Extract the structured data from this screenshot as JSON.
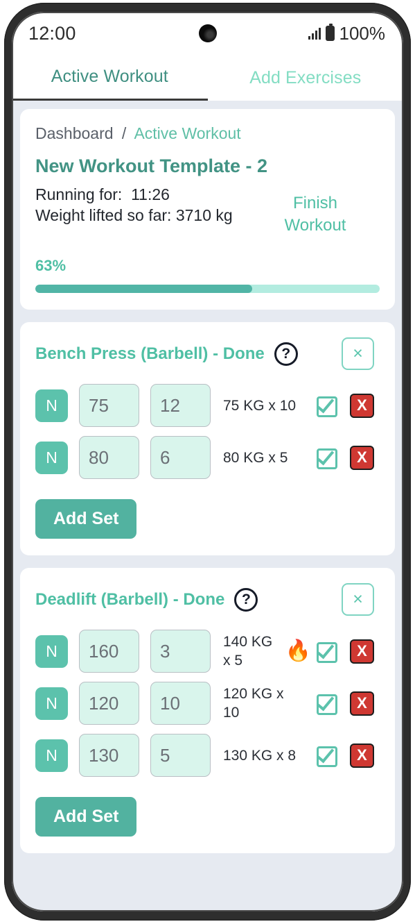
{
  "status_bar": {
    "time": "12:00",
    "battery_percent": "100%",
    "signal_icon": "signal-bars-icon",
    "battery_icon": "battery-full-icon",
    "camera_icon": "front-camera-punch-hole"
  },
  "tabs": [
    {
      "label": "Active Workout",
      "active": true
    },
    {
      "label": "Add Exercises",
      "active": false
    }
  ],
  "header": {
    "breadcrumb": {
      "root": "Dashboard",
      "separator": "/",
      "current": "Active Workout"
    },
    "workout_title": "New Workout Template - 2",
    "running_for_label": "Running for:",
    "running_for_value": "11:26",
    "weight_lifted": "Weight lifted so far: 3710 kg",
    "finish_button": "Finish Workout",
    "progress_percent_label": "63%",
    "progress_percent_value": 63,
    "accent_color": "#4fbfa4",
    "progress_fill_color": "#51b5a6",
    "progress_track_color": "#b3ece0"
  },
  "exercises": [
    {
      "title": "Bench Press (Barbell) - Done",
      "help_icon": "question-mark-icon",
      "remove_icon": "close-x-icon",
      "add_set_label": "Add Set",
      "sets": [
        {
          "badge": "N",
          "weight": "75",
          "reps": "12",
          "target": "75 KG x 10",
          "has_record": false,
          "check_icon": "checkbox-checked-icon",
          "delete_label": "X"
        },
        {
          "badge": "N",
          "weight": "80",
          "reps": "6",
          "target": "80 KG x 5",
          "has_record": false,
          "check_icon": "checkbox-checked-icon",
          "delete_label": "X"
        }
      ]
    },
    {
      "title": "Deadlift (Barbell) - Done",
      "help_icon": "question-mark-icon",
      "remove_icon": "close-x-icon",
      "add_set_label": "Add Set",
      "sets": [
        {
          "badge": "N",
          "weight": "160",
          "reps": "3",
          "target": "140 KG x 5",
          "has_record": true,
          "record_icon": "fire-emoji",
          "check_icon": "checkbox-checked-icon",
          "delete_label": "X"
        },
        {
          "badge": "N",
          "weight": "120",
          "reps": "10",
          "target": "120 KG x 10",
          "has_record": false,
          "check_icon": "checkbox-checked-icon",
          "delete_label": "X"
        },
        {
          "badge": "N",
          "weight": "130",
          "reps": "5",
          "target": "130 KG x 8",
          "has_record": false,
          "check_icon": "checkbox-checked-icon",
          "delete_label": "X"
        }
      ]
    }
  ]
}
